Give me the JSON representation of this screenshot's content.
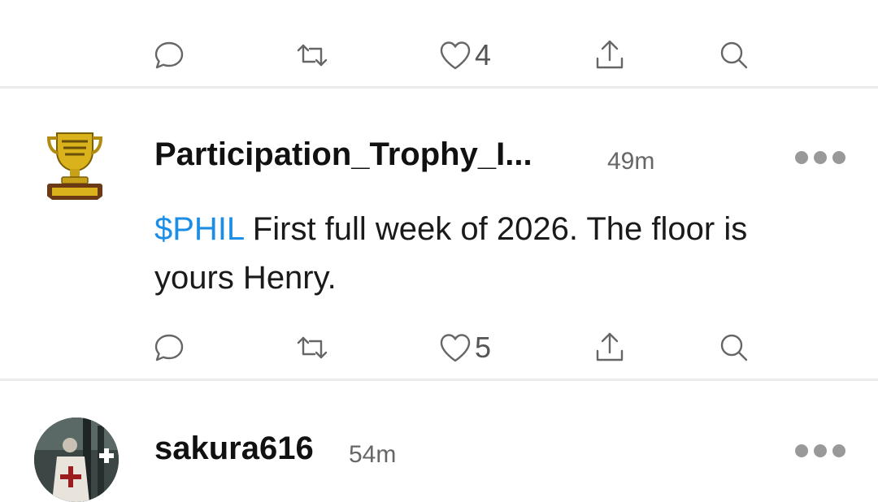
{
  "posts": [
    {
      "actions": {
        "like_count": "4"
      }
    },
    {
      "username": "Participation_Trophy_I...",
      "time": "49m",
      "ticker": "$PHIL",
      "text": " First full week of 2026. The floor is yours Henry.",
      "actions": {
        "like_count": "5"
      }
    },
    {
      "username": "sakura616",
      "time": "54m"
    }
  ],
  "icons": {
    "reply": "reply-icon",
    "repost": "repost-icon",
    "like": "heart-icon",
    "share": "share-icon",
    "search": "search-icon",
    "more": "more-icon"
  },
  "colors": {
    "ticker": "#1d8ee6",
    "divider": "#ebebeb"
  }
}
